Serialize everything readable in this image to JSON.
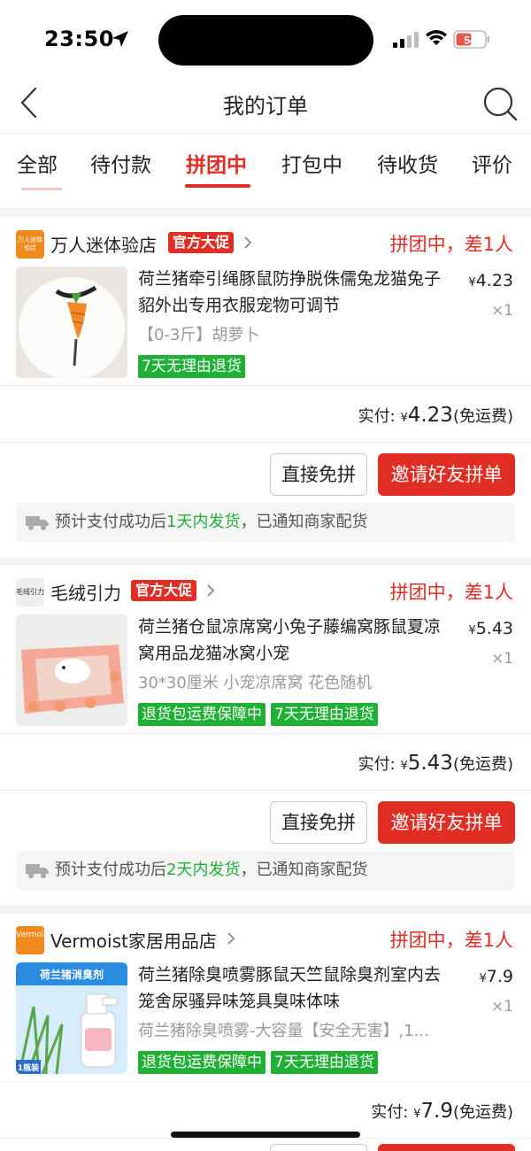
{
  "status_bar": {
    "time": "23:50",
    "battery": "54"
  },
  "nav": {
    "title": "我的订单"
  },
  "tabs": [
    {
      "label": "全部"
    },
    {
      "label": "待付款"
    },
    {
      "label": "拼团中",
      "active": true
    },
    {
      "label": "打包中"
    },
    {
      "label": "待收货"
    },
    {
      "label": "评价"
    }
  ],
  "orders": [
    {
      "store_logo_text": "万人迷体验店",
      "store_name": "万人迷体验店",
      "badge": "官方大促",
      "status": "拼团中，差1人",
      "title": "荷兰猪牵引绳豚鼠防挣脱侏儒兔龙猫兔子貂外出专用衣服宠物可调节",
      "price_symbol": "¥",
      "price": "4.23",
      "qty": "×1",
      "sku": "【0-3斤】胡萝卜",
      "tags": [
        "7天无理由退货"
      ],
      "paid_label": "实付:",
      "paid_symbol": "¥",
      "paid_amount": "4.23",
      "paid_note": "(免运费)",
      "btn_secondary": "直接免拼",
      "btn_primary": "邀请好友拼单",
      "ship_prefix": "预计支付成功后",
      "ship_highlight": "1天内发货",
      "ship_suffix": "，已通知商家配货"
    },
    {
      "store_logo_text": "毛绒引力",
      "store_name": "毛绒引力",
      "badge": "官方大促",
      "status": "拼团中，差1人",
      "title": "荷兰猪仓鼠凉席窝小兔子藤编窝豚鼠夏凉窝用品龙猫冰窝小宠",
      "price_symbol": "¥",
      "price": "5.43",
      "qty": "×1",
      "sku": "30*30厘米 小宠凉席窝 花色随机",
      "tags": [
        "退货包运费保障中",
        "7天无理由退货"
      ],
      "paid_label": "实付:",
      "paid_symbol": "¥",
      "paid_amount": "5.43",
      "paid_note": "(免运费)",
      "btn_secondary": "直接免拼",
      "btn_primary": "邀请好友拼单",
      "ship_prefix": "预计支付成功后",
      "ship_highlight": "2天内发货",
      "ship_suffix": "，已通知商家配货"
    },
    {
      "store_logo_text": "Vermoist",
      "store_name": "Vermoist家居用品店",
      "status": "拼团中，差1人",
      "title": "荷兰猪除臭喷雾豚鼠天竺鼠除臭剂室内去笼舍尿骚异味笼具臭味体味",
      "thumb_text": "荷兰猪消臭剂",
      "thumb_corner": "1瓶装",
      "price_symbol": "¥",
      "price": "7.9",
      "qty": "×1",
      "sku": "荷兰猪除臭喷雾-大容量【安全无害】,1...",
      "tags": [
        "退货包运费保障中",
        "7天无理由退货"
      ],
      "paid_label": "实付:",
      "paid_symbol": "¥",
      "paid_amount": "7.9",
      "paid_note": "(免运费)"
    }
  ],
  "colors": {
    "accent": "#e02e24",
    "tag_green": "#1fb035",
    "text": "#222222",
    "muted": "#999999"
  }
}
